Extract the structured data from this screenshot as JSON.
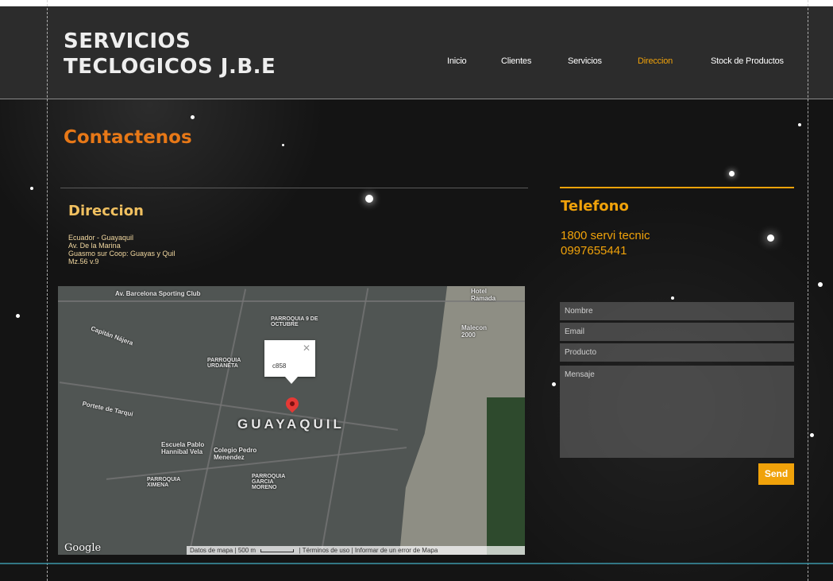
{
  "site": {
    "title_line1": "SERVICIOS",
    "title_line2": "TECLOGICOS J.B.E"
  },
  "nav": {
    "items": [
      {
        "label": "Inicio"
      },
      {
        "label": "Clientes"
      },
      {
        "label": "Servicios"
      },
      {
        "label": "Direccion"
      },
      {
        "label": "Stock de Productos"
      }
    ]
  },
  "main": {
    "heading": "Contactenos",
    "address": {
      "title": "Direccion",
      "lines": [
        "Ecuador - Guayaquil",
        "Av. De la Marina",
        "Guasmo sur Coop: Guayas y Quil",
        "Mz.56   v.9"
      ]
    },
    "phone": {
      "title": "Telefono",
      "lines": [
        "1800 servi tecnic",
        "0997655441"
      ]
    }
  },
  "map": {
    "city_label": "GUAYAQUIL",
    "labels": [
      "Av. Barcelona Sporting Club",
      "Hotel Ramada",
      "Malecon 2000",
      "PARROQUIA 9 DE OCTUBRE",
      "PARROQUIA URDANETA",
      "Capitán Nájera",
      "Portete de Tarqui",
      "Escuela Pablo Hannibal Vela",
      "Colegio Pedro Menendez",
      "PARROQUIA GARCIA MORENO",
      "PARROQUIA XIMENA"
    ],
    "info_window_text": "c858",
    "google_label": "Google",
    "footer": {
      "data": "Datos de mapa",
      "scale": "500 m",
      "terms": "Términos de uso",
      "report": "Informar de un error de Mapa"
    }
  },
  "form": {
    "name_placeholder": "Nombre",
    "email_placeholder": "Email",
    "product_placeholder": "Producto",
    "message_placeholder": "Mensaje",
    "send_label": "Send"
  },
  "colors": {
    "accent": "#f0a20a",
    "heading": "#e77817",
    "header_bg": "#2c2c2c"
  }
}
